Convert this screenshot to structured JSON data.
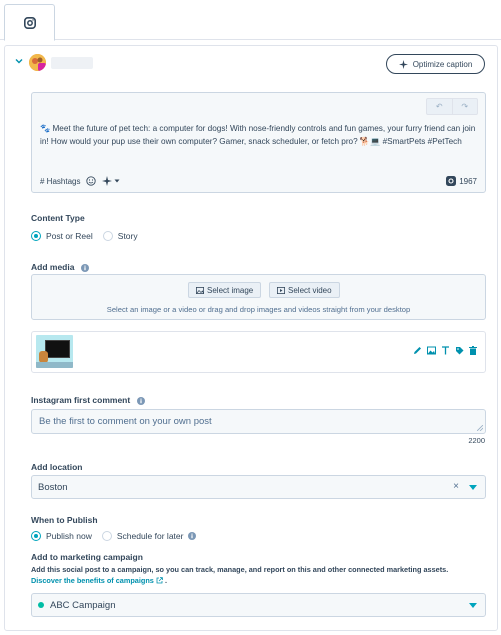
{
  "composer": {
    "optimize_caption_label": "Optimize caption",
    "undo_glyph": "↶",
    "redo_glyph": "↷",
    "caption_text": "🐾 Meet the future of pet tech: a computer for dogs! With nose-friendly controls and fun games, your furry friend can join in! How would your pup use their own computer? Gamer, snack scheduler, or fetch pro? 🐕💻 #SmartPets #PetTech",
    "hashtags_label": "# Hashtags",
    "char_count": "1967"
  },
  "content_type": {
    "title": "Content Type",
    "options": [
      "Post or Reel",
      "Story"
    ],
    "selected": "Post or Reel"
  },
  "media": {
    "title": "Add media",
    "select_image_label": "Select image",
    "select_video_label": "Select video",
    "hint": "Select an image or a video or drag and drop images and videos straight from your desktop"
  },
  "first_comment": {
    "title": "Instagram first comment",
    "placeholder": "Be the first to comment on your own post",
    "char_count": "2200"
  },
  "location": {
    "title": "Add location",
    "value": "Boston",
    "clear_glyph": "×"
  },
  "publish": {
    "title": "When to Publish",
    "options": [
      "Publish now",
      "Schedule for later"
    ],
    "selected": "Publish now"
  },
  "campaign": {
    "title": "Add to marketing campaign",
    "description": "Add this social post to a campaign, so you can track, manage, and report on this and other connected marketing assets.",
    "link_label": "Discover the benefits of campaigns",
    "link_suffix": ".",
    "value": "ABC Campaign"
  },
  "colors": {
    "accent": "#00a4bd",
    "link": "#0091ae",
    "campaign_dot": "#00bda5",
    "text": "#33475b",
    "field_bg": "#f5f8fa",
    "border": "#cbd6e2"
  }
}
